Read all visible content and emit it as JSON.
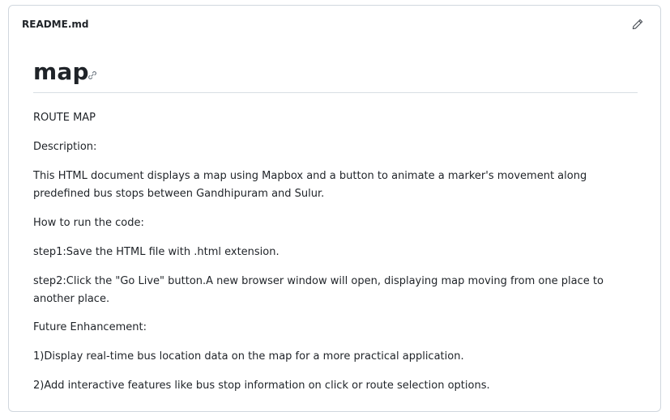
{
  "readme": {
    "filename": "README.md",
    "title": "map",
    "icons": {
      "edit": "pencil-icon",
      "anchor": "link-icon"
    },
    "paragraphs": [
      "ROUTE MAP",
      "Description:",
      "This HTML document displays a map using Mapbox and a button to animate a marker's movement along predefined bus stops between Gandhipuram and Sulur.",
      "How to run the code:",
      "step1:Save the HTML file with .html extension.",
      "step2:Click the \"Go Live\" button.A new browser window will open, displaying map moving from one place to another place.",
      "Future Enhancement:",
      "1)Display real-time bus location data on the map for a more practical application.",
      "2)Add interactive features like bus stop information on click or route selection options."
    ]
  }
}
